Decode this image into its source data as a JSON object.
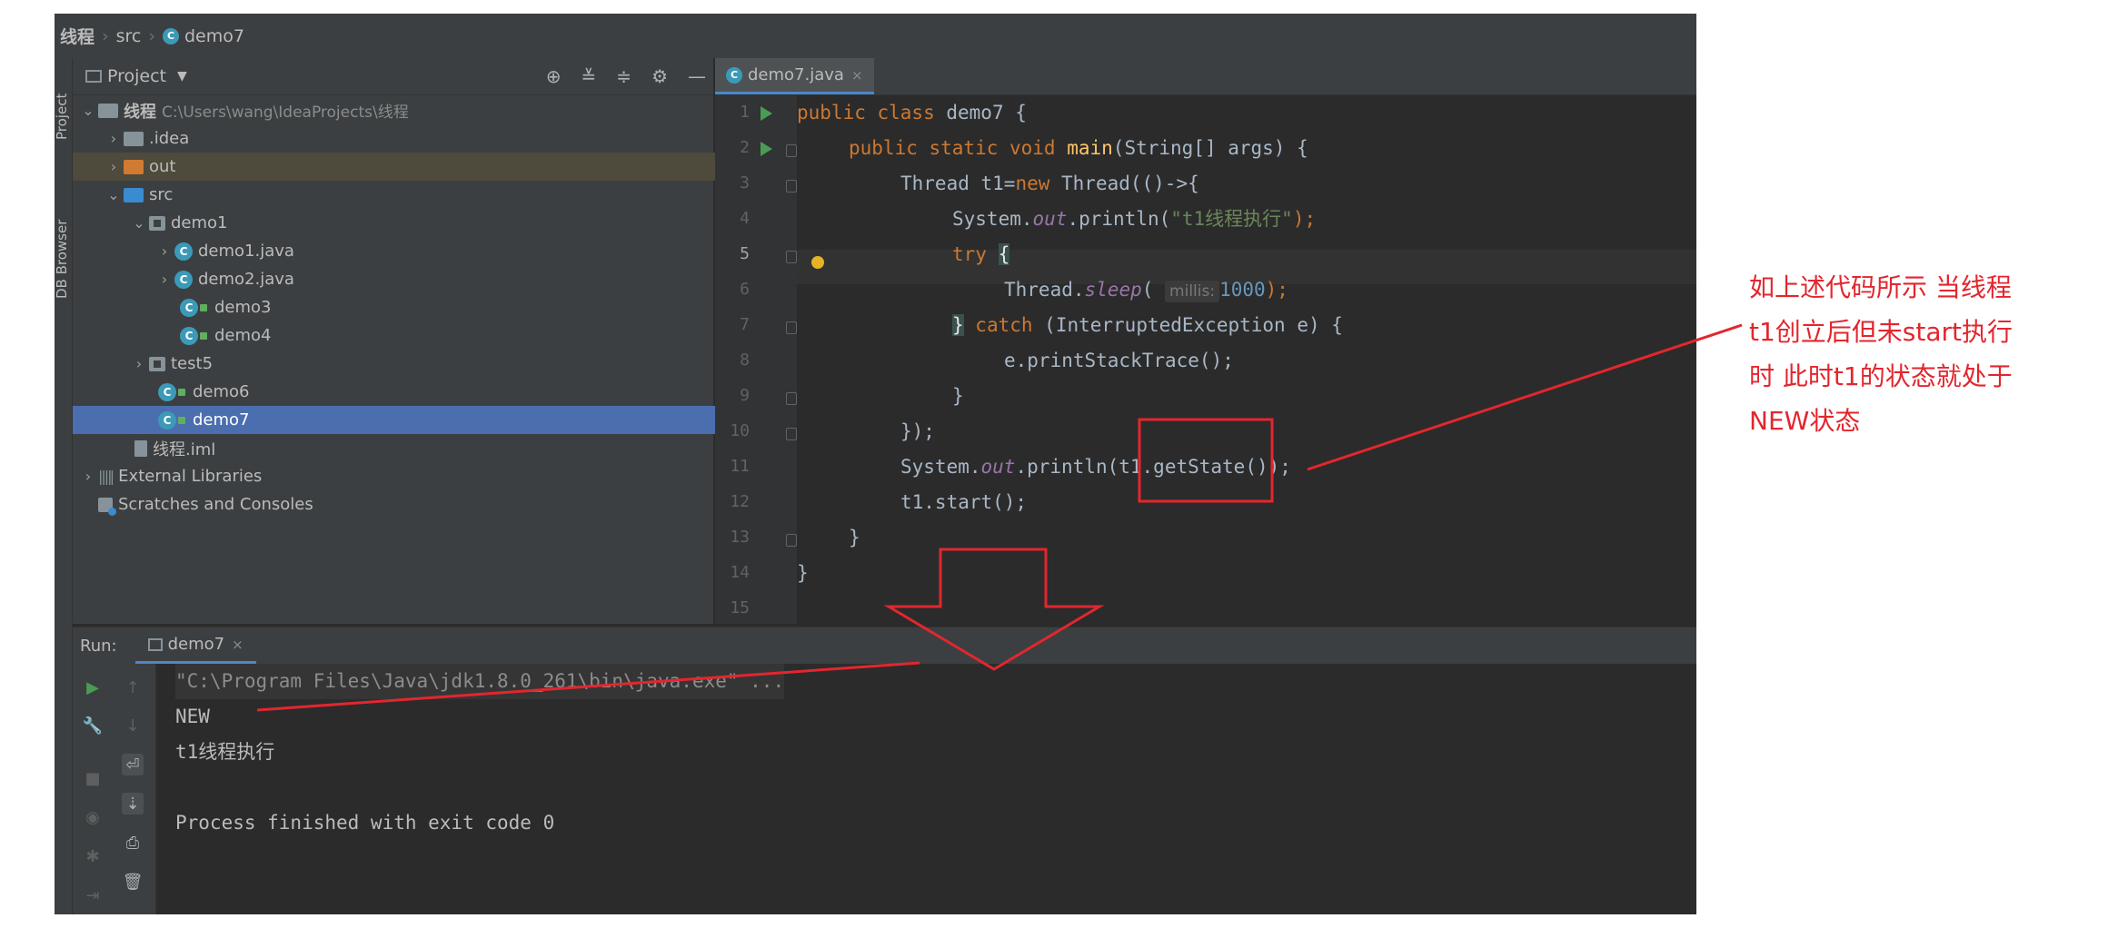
{
  "breadcrumb": {
    "project": "线程",
    "src": "src",
    "file": "demo7"
  },
  "stripe": {
    "project_label": "Project",
    "db_label": "DB Browser"
  },
  "project_panel": {
    "title": "Project",
    "root": {
      "name": "线程",
      "path": "C:\\Users\\wang\\IdeaProjects\\线程"
    },
    "items": [
      {
        "label": ".idea"
      },
      {
        "label": "out"
      },
      {
        "label": "src"
      },
      {
        "label": "demo1"
      },
      {
        "label": "demo1.java"
      },
      {
        "label": "demo2.java"
      },
      {
        "label": "demo3"
      },
      {
        "label": "demo4"
      },
      {
        "label": "test5"
      },
      {
        "label": "demo6"
      },
      {
        "label": "demo7"
      },
      {
        "label": "线程.iml"
      },
      {
        "label": "External Libraries"
      },
      {
        "label": "Scratches and Consoles"
      }
    ]
  },
  "editor": {
    "tab_label": "demo7.java",
    "line_numbers": [
      "1",
      "2",
      "3",
      "4",
      "5",
      "6",
      "7",
      "8",
      "9",
      "10",
      "11",
      "12",
      "13",
      "14",
      "15"
    ],
    "current_line": "5",
    "code": {
      "l1": {
        "kw": "public class ",
        "rest": "demo7 {"
      },
      "l2": {
        "kw": "public static void ",
        "fn": "main",
        "rest": "(String[] args) {"
      },
      "l3": {
        "a": "Thread t1=",
        "kw": "new ",
        "b": "Thread(()->{"
      },
      "l4": {
        "a": "System.",
        "it": "out",
        "b": ".println(",
        "st": "\"t1线程执行\"",
        "c": ");"
      },
      "l5": {
        "kw": "try ",
        "brace": "{"
      },
      "l6": {
        "a": "Thread.",
        "it": "sleep",
        "b": "( ",
        "hint": "millis:",
        "num": "1000",
        "c": ");"
      },
      "l7": {
        "brace": "}",
        "kw": " catch ",
        "rest": "(InterruptedException e) {"
      },
      "l8": {
        "a": "e.printStackTrace();"
      },
      "l9": {
        "a": "}"
      },
      "l10": {
        "a": "});"
      },
      "l11": {
        "a": "System.",
        "it": "out",
        "b": ".println(t1.getState());"
      },
      "l12": {
        "a": "t1.start();"
      },
      "l13": {
        "a": "}"
      },
      "l14": {
        "a": "}"
      }
    }
  },
  "run_panel": {
    "label": "Run:",
    "tab_label": "demo7",
    "console": {
      "cmd": "\"C:\\Program Files\\Java\\jdk1.8.0_261\\bin\\java.exe\" ...",
      "out1": "NEW",
      "out2": "t1线程执行",
      "out3": "Process finished with exit code 0"
    }
  },
  "annotation": {
    "lines": [
      "如上述代码所示 当线程",
      "t1创立后但未start执行",
      "时 此时t1的状态就处于",
      "NEW状态"
    ],
    "color": "#e3262e"
  },
  "colors": {
    "keyword": "#cc7832",
    "function": "#ffc66d",
    "string": "#6a8759",
    "field": "#9876aa",
    "number": "#6897bb",
    "selection": "#4b6eaf"
  }
}
